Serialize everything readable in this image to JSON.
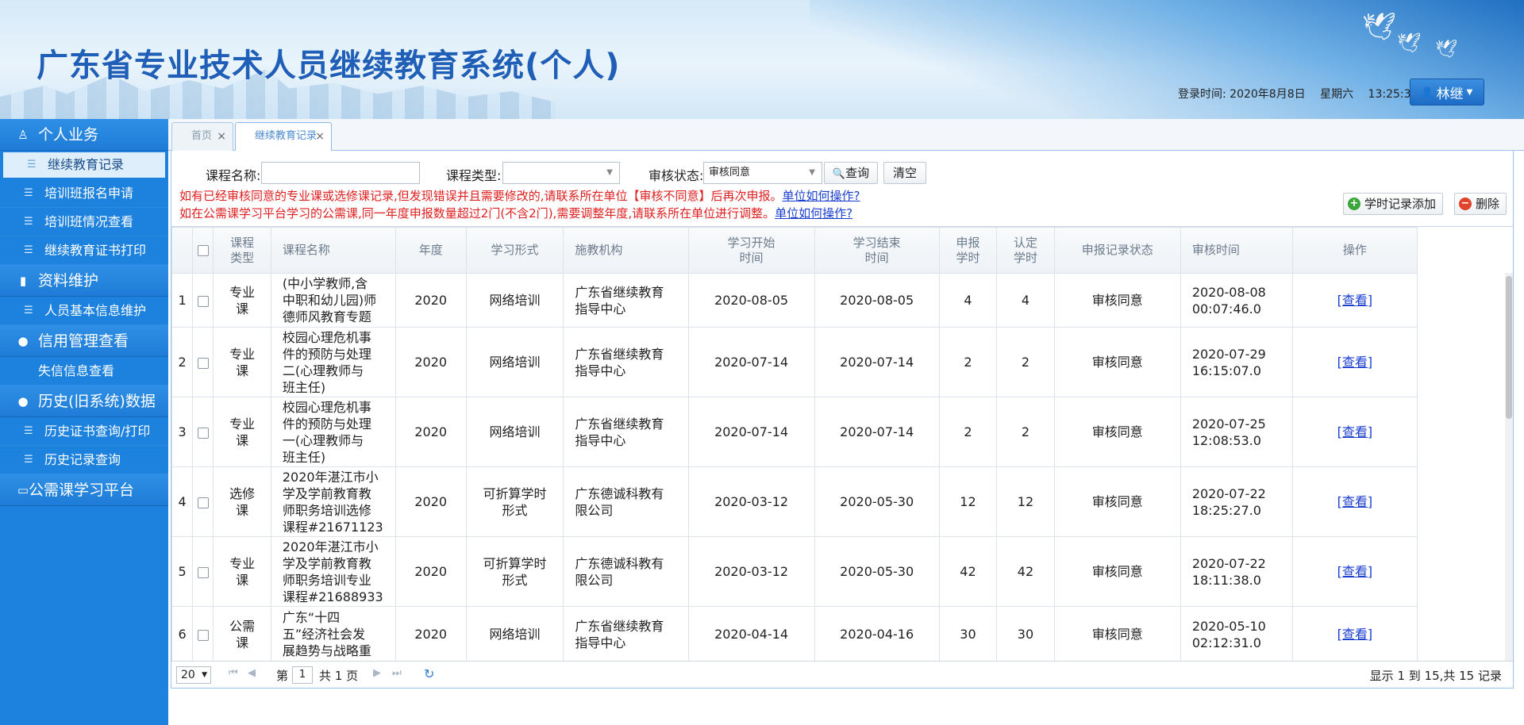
{
  "header": {
    "title": "广东省专业技术人员继续教育系统(个人)",
    "login_time_label": "登录时间:",
    "login_date": "2020年8月8日",
    "weekday": "星期六",
    "clock": "13:25:36",
    "user_name": "林继"
  },
  "sidebar": {
    "groups": [
      {
        "label": "个人业务",
        "icon": "person-icon",
        "items": [
          "继续教育记录",
          "培训班报名申请",
          "培训班情况查看",
          "继续教育证书打印"
        ]
      },
      {
        "label": "资料维护",
        "icon": "book-icon",
        "items": [
          "人员基本信息维护"
        ]
      },
      {
        "label": "信用管理查看",
        "icon": "lightbulb-icon",
        "items": [
          "失信信息查看"
        ]
      },
      {
        "label": "历史(旧系统)数据",
        "icon": "lightbulb-icon",
        "items": [
          "历史证书查询/打印",
          "历史记录查询"
        ]
      },
      {
        "label": "公需课学习平台",
        "icon": "monitor-icon",
        "items": []
      }
    ],
    "active_item": "继续教育记录"
  },
  "tabs": [
    {
      "label": "首页",
      "active": false
    },
    {
      "label": "继续教育记录",
      "active": true
    }
  ],
  "filters": {
    "course_name_label": "课程名称:",
    "course_name_value": "",
    "course_type_label": "课程类型:",
    "course_type_value": "",
    "audit_status_label": "审核状态:",
    "audit_status_value": "审核同意",
    "query_label": "查询",
    "clear_label": "清空"
  },
  "notices": {
    "line1": "如有已经审核同意的专业课或选修课记录,但发现错误并且需要修改的,请联系所在单位【审核不同意】后再次申报。",
    "line2": "如在公需课学习平台学习的公需课,同一年度申报数量超过2门(不含2门),需要调整年度,请联系所在单位进行调整。",
    "link_label": "单位如何操作?"
  },
  "actions": {
    "add_label": "学时记录添加",
    "delete_label": "删除"
  },
  "table": {
    "columns": [
      "",
      "",
      "课程\n类型",
      "课程名称",
      "年度",
      "学习形式",
      "施教机构",
      "学习开始\n时间",
      "学习结束\n时间",
      "申报\n学时",
      "认定\n学时",
      "申报记录状态",
      "审核时间",
      "操作"
    ],
    "rows": [
      {
        "no": "1",
        "type": "专业\n课",
        "name": "(中小学教师,含\n中职和幼儿园)师\n德师风教育专题",
        "year": "2020",
        "form": "网络培训",
        "org": "广东省继续教育\n指导中心",
        "start": "2020-08-05",
        "end": "2020-08-05",
        "hours": "4",
        "approved": "4",
        "status": "审核同意",
        "audit_time": "2020-08-08\n00:07:46.0",
        "op": "[查看]"
      },
      {
        "no": "2",
        "type": "专业\n课",
        "name": "校园心理危机事\n件的预防与处理\n二(心理教师与\n班主任)",
        "year": "2020",
        "form": "网络培训",
        "org": "广东省继续教育\n指导中心",
        "start": "2020-07-14",
        "end": "2020-07-14",
        "hours": "2",
        "approved": "2",
        "status": "审核同意",
        "audit_time": "2020-07-29\n16:15:07.0",
        "op": "[查看]"
      },
      {
        "no": "3",
        "type": "专业\n课",
        "name": "校园心理危机事\n件的预防与处理\n一(心理教师与\n班主任)",
        "year": "2020",
        "form": "网络培训",
        "org": "广东省继续教育\n指导中心",
        "start": "2020-07-14",
        "end": "2020-07-14",
        "hours": "2",
        "approved": "2",
        "status": "审核同意",
        "audit_time": "2020-07-25\n12:08:53.0",
        "op": "[查看]"
      },
      {
        "no": "4",
        "type": "选修\n课",
        "name": "2020年湛江市小\n学及学前教育教\n师职务培训选修\n课程#21671123",
        "year": "2020",
        "form": "可折算学时\n形式",
        "org": "广东德诚科教有\n限公司",
        "start": "2020-03-12",
        "end": "2020-05-30",
        "hours": "12",
        "approved": "12",
        "status": "审核同意",
        "audit_time": "2020-07-22\n18:25:27.0",
        "op": "[查看]"
      },
      {
        "no": "5",
        "type": "专业\n课",
        "name": "2020年湛江市小\n学及学前教育教\n师职务培训专业\n课程#21688933",
        "year": "2020",
        "form": "可折算学时\n形式",
        "org": "广东德诚科教有\n限公司",
        "start": "2020-03-12",
        "end": "2020-05-30",
        "hours": "42",
        "approved": "42",
        "status": "审核同意",
        "audit_time": "2020-07-22\n18:11:38.0",
        "op": "[查看]"
      },
      {
        "no": "6",
        "type": "公需\n课",
        "name": "广东“十四\n五”经济社会发\n展趋势与战略重",
        "year": "2020",
        "form": "网络培训",
        "org": "广东省继续教育\n指导中心",
        "start": "2020-04-14",
        "end": "2020-04-16",
        "hours": "30",
        "approved": "30",
        "status": "审核同意",
        "audit_time": "2020-05-10\n02:12:31.0",
        "op": "[查看]"
      }
    ]
  },
  "pager": {
    "page_size": "20",
    "page_prefix": "第",
    "page_number": "1",
    "page_suffix": "共 1 页",
    "summary": "显示 1 到 15,共 15 记录"
  },
  "colors": {
    "sidebar": "#1c82de",
    "title": "#1f5fb8",
    "notice": "#e02020",
    "link": "#1a3fd0"
  }
}
